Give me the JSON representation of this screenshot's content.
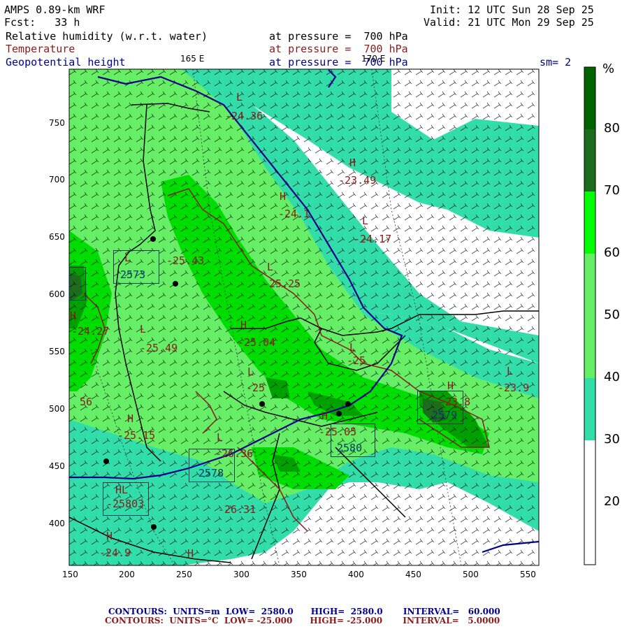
{
  "header": {
    "model": "AMPS 0.89-km WRF",
    "forecast": "Fcst:   33 h",
    "init": "Init: 12 UTC Sun 28 Sep 25",
    "valid": "Valid: 21 UTC Mon 29 Sep 25",
    "field1": "Relative humidity (w.r.t. water)",
    "field2": "Temperature",
    "field3": "Geopotential height",
    "pressure1": "at pressure =  700 hPa",
    "pressure2": "at pressure =  700 hPa",
    "pressure3": "at pressure =  700 hPa",
    "lon_label_left": "165 E",
    "lon_label_right": "170 E",
    "smoothing": "sm= 2"
  },
  "colorbar": {
    "unit": "%",
    "labels": [
      "80",
      "70",
      "60",
      "50",
      "40",
      "30",
      "20"
    ],
    "colors": [
      "#006400",
      "#00a000",
      "#00ff00",
      "#66ee66",
      "#33ddaa",
      "#ffffff"
    ]
  },
  "axes": {
    "x_ticks": [
      "150",
      "200",
      "250",
      "300",
      "350",
      "400",
      "450",
      "500",
      "550"
    ],
    "y_ticks": [
      "750",
      "700",
      "650",
      "600",
      "550",
      "500",
      "450",
      "400"
    ]
  },
  "annotations": [
    {
      "text": "L",
      "color": "brown"
    },
    {
      "text": "-24.36",
      "color": "brown"
    },
    {
      "text": "H",
      "color": "brown"
    },
    {
      "text": "-23.49",
      "color": "brown"
    },
    {
      "text": "H",
      "color": "brown"
    },
    {
      "text": "-24.1",
      "color": "brown"
    },
    {
      "text": "L",
      "color": "brown"
    },
    {
      "text": "-24.17",
      "color": "brown"
    },
    {
      "text": "L",
      "color": "brown"
    },
    {
      "text": "-25.43",
      "color": "brown"
    },
    {
      "text": "L",
      "color": "brown"
    },
    {
      "text": "-25.25",
      "color": "brown"
    },
    {
      "text": "2573",
      "color": "blue"
    },
    {
      "text": "H",
      "color": "brown"
    },
    {
      "text": "-24.27",
      "color": "brown"
    },
    {
      "text": "L",
      "color": "brown"
    },
    {
      "text": "-25.49",
      "color": "brown"
    },
    {
      "text": "H",
      "color": "brown"
    },
    {
      "text": "-25.04",
      "color": "brown"
    },
    {
      "text": "L",
      "color": "brown"
    },
    {
      "text": "-25",
      "color": "brown"
    },
    {
      "text": "L",
      "color": "brown"
    },
    {
      "text": "-25",
      "color": "brown"
    },
    {
      "text": "L",
      "color": "brown"
    },
    {
      "text": "-23.9",
      "color": "brown"
    },
    {
      "text": "H",
      "color": "brown"
    },
    {
      "text": "-23.8",
      "color": "brown"
    },
    {
      "text": "2579",
      "color": "blue"
    },
    {
      "text": "H",
      "color": "brown"
    },
    {
      "text": "-25.15",
      "color": "brown"
    },
    {
      "text": "H",
      "color": "brown"
    },
    {
      "text": "-25.05",
      "color": "brown"
    },
    {
      "text": "2580",
      "color": "blue"
    },
    {
      "text": "L",
      "color": "brown"
    },
    {
      "text": "-26.36",
      "color": "brown"
    },
    {
      "text": "2578",
      "color": "blue"
    },
    {
      "text": "-26.31",
      "color": "brown"
    },
    {
      "text": "HL",
      "color": "brown"
    },
    {
      "text": "-25803",
      "color": "brown"
    },
    {
      "text": "H",
      "color": "brown"
    },
    {
      "text": "-24.9",
      "color": "brown"
    },
    {
      "text": "H",
      "color": "brown"
    },
    {
      "text": "56",
      "color": "brown"
    }
  ],
  "footer": {
    "line1": "CONTOURS:  UNITS=m  LOW=  2580.0      HIGH=  2580.0       INTERVAL=   60.000",
    "line2": "CONTOURS:  UNITS=°C  LOW= -25.000      HIGH= -25.000       INTERVAL=   5.0000"
  }
}
